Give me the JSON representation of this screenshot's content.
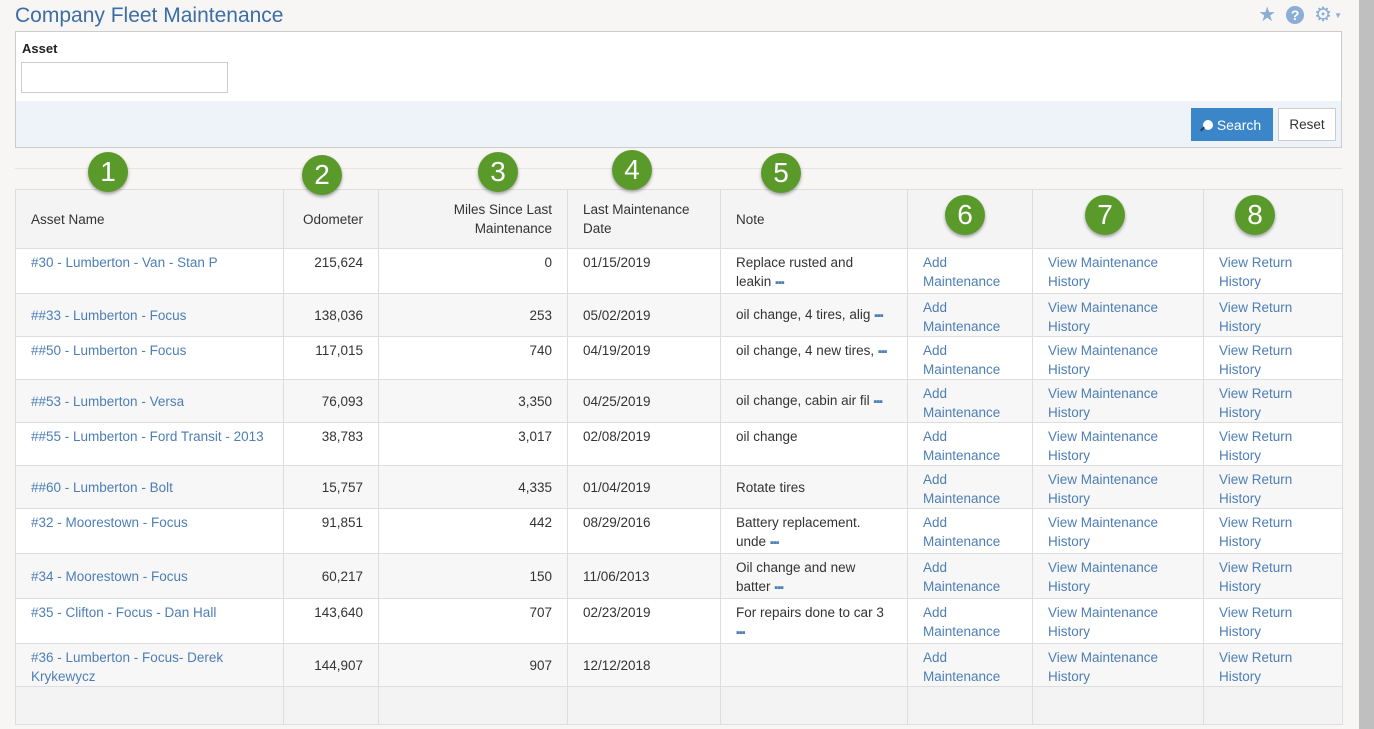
{
  "header": {
    "title": "Company Fleet Maintenance",
    "icons": [
      "star-icon",
      "help-icon",
      "gear-icon"
    ]
  },
  "filter": {
    "asset_label": "Asset",
    "asset_value": "",
    "asset_placeholder": "",
    "search_label": "Search",
    "reset_label": "Reset"
  },
  "badges": [
    "1",
    "2",
    "3",
    "4",
    "5",
    "6",
    "7",
    "8"
  ],
  "table": {
    "columns": [
      "Asset Name",
      "Odometer",
      "Miles Since Last Maintenance",
      "Last Maintenance Date",
      "Note",
      "",
      "",
      ""
    ],
    "rows": [
      {
        "asset": "#30 - Lumberton - Van - Stan P",
        "odometer": "215,624",
        "miles": "0",
        "date": "01/15/2019",
        "note": "Replace rusted and leakin",
        "note_more": true,
        "add": "Add Maintenance",
        "view_maint": "View Maintenance History",
        "view_return": "View Return History"
      },
      {
        "asset": "##33 - Lumberton - Focus",
        "odometer": "138,036",
        "miles": "253",
        "date": "05/02/2019",
        "note": "oil change, 4 tires, alig",
        "note_more": true,
        "add": "Add Maintenance",
        "view_maint": "View Maintenance History",
        "view_return": "View Return History"
      },
      {
        "asset": "##50 - Lumberton - Focus",
        "odometer": "117,015",
        "miles": "740",
        "date": "04/19/2019",
        "note": "oil change, 4 new tires,",
        "note_more": true,
        "add": "Add Maintenance",
        "view_maint": "View Maintenance History",
        "view_return": "View Return History"
      },
      {
        "asset": "##53 - Lumberton - Versa",
        "odometer": "76,093",
        "miles": "3,350",
        "date": "04/25/2019",
        "note": "oil change, cabin air fil",
        "note_more": true,
        "add": "Add Maintenance",
        "view_maint": "View Maintenance History",
        "view_return": "View Return History"
      },
      {
        "asset": "##55 - Lumberton - Ford Transit - 2013",
        "odometer": "38,783",
        "miles": "3,017",
        "date": "02/08/2019",
        "note": "oil change",
        "note_more": false,
        "add": "Add Maintenance",
        "view_maint": "View Maintenance History",
        "view_return": "View Return History"
      },
      {
        "asset": "##60 - Lumberton - Bolt",
        "odometer": "15,757",
        "miles": "4,335",
        "date": "01/04/2019",
        "note": "Rotate tires",
        "note_more": false,
        "add": "Add Maintenance",
        "view_maint": "View Maintenance History",
        "view_return": "View Return History"
      },
      {
        "asset": "#32 - Moorestown - Focus",
        "odometer": "91,851",
        "miles": "442",
        "date": "08/29/2016",
        "note": "Battery replacement. unde",
        "note_more": true,
        "add": "Add Maintenance",
        "view_maint": "View Maintenance History",
        "view_return": "View Return History"
      },
      {
        "asset": "#34 - Moorestown - Focus",
        "odometer": "60,217",
        "miles": "150",
        "date": "11/06/2013",
        "note": "Oil change and new batter",
        "note_more": true,
        "add": "Add Maintenance",
        "view_maint": "View Maintenance History",
        "view_return": "View Return History"
      },
      {
        "asset": "#35 - Clifton - Focus - Dan Hall",
        "odometer": "143,640",
        "miles": "707",
        "date": "02/23/2019",
        "note": "For repairs done to car 3",
        "note_more": true,
        "add": "Add Maintenance",
        "view_maint": "View Maintenance History",
        "view_return": "View Return History"
      },
      {
        "asset": "#36 - Lumberton - Focus- Derek Krykewycz",
        "odometer": "144,907",
        "miles": "907",
        "date": "12/12/2018",
        "note": "",
        "note_more": false,
        "add": "Add Maintenance",
        "view_maint": "View Maintenance History",
        "view_return": "View Return History"
      }
    ],
    "more_glyph": "▪▪▪"
  },
  "colors": {
    "title": "#3b6ea5",
    "link": "#4d7eb6",
    "search_button": "#3a86c8",
    "badge": "#5a9a2b"
  }
}
